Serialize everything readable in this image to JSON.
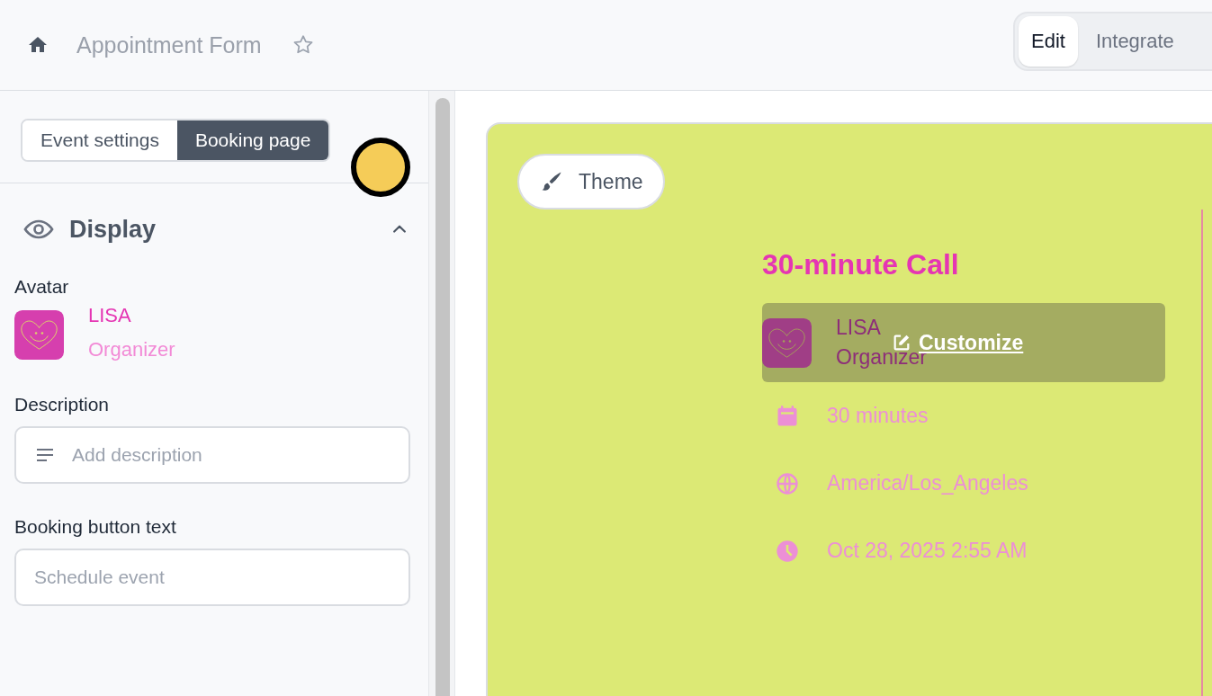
{
  "header": {
    "title": "Appointment Form",
    "view_tabs": [
      {
        "label": "Edit",
        "selected": true
      },
      {
        "label": "Integrate",
        "selected": false
      }
    ]
  },
  "sidebar": {
    "tabs": [
      {
        "label": "Event settings",
        "selected": false
      },
      {
        "label": "Booking page",
        "selected": true
      }
    ],
    "section": {
      "title": "Display",
      "expanded": true
    },
    "avatar": {
      "label": "Avatar",
      "name": "LISA",
      "role": "Organizer"
    },
    "fields": [
      {
        "label": "Description",
        "placeholder": "Add description",
        "kind": "textarea"
      },
      {
        "label": "Booking button text",
        "placeholder": "Schedule event",
        "kind": "text"
      }
    ]
  },
  "preview": {
    "theme_button": "Theme",
    "title": "30-minute Call",
    "organizer": {
      "name": "LISA",
      "role": "Organizer"
    },
    "customize": "Customize",
    "details": [
      {
        "kind": "duration",
        "text": "30 minutes"
      },
      {
        "kind": "timezone",
        "text": "America/Los_Angeles"
      },
      {
        "kind": "datetime",
        "text": "Oct 28, 2025 2:55 AM"
      }
    ]
  }
}
